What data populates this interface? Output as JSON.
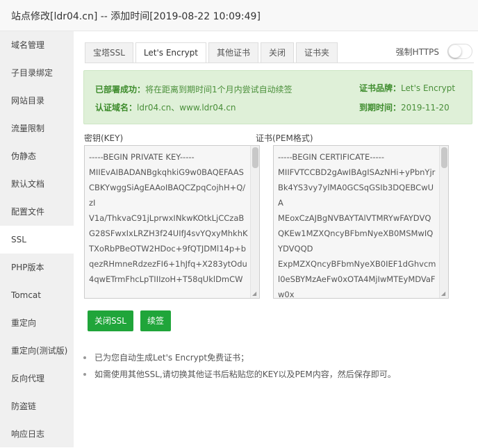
{
  "window": {
    "title": "站点修改[ldr04.cn] -- 添加时间[2019-08-22 10:09:49]"
  },
  "sidebar": {
    "items": [
      {
        "label": "域名管理"
      },
      {
        "label": "子目录绑定"
      },
      {
        "label": "网站目录"
      },
      {
        "label": "流量限制"
      },
      {
        "label": "伪静态"
      },
      {
        "label": "默认文档"
      },
      {
        "label": "配置文件"
      },
      {
        "label": "SSL",
        "active": true
      },
      {
        "label": "PHP版本"
      },
      {
        "label": "Tomcat"
      },
      {
        "label": "重定向"
      },
      {
        "label": "重定向(测试版)"
      },
      {
        "label": "反向代理"
      },
      {
        "label": "防盗链"
      },
      {
        "label": "响应日志"
      }
    ]
  },
  "tabs": [
    {
      "label": "宝塔SSL"
    },
    {
      "label": "Let's Encrypt",
      "active": true
    },
    {
      "label": "其他证书"
    },
    {
      "label": "关闭"
    },
    {
      "label": "证书夹"
    }
  ],
  "force_https": {
    "label": "强制HTTPS",
    "enabled": false
  },
  "status": {
    "deployed_label": "已部署成功：",
    "deployed_value": "将在距离到期时间1个月内尝试自动续签",
    "brand_label": "证书品牌：",
    "brand_value": "Let's Encrypt",
    "domain_label": "认证域名：",
    "domain_value": "ldr04.cn、www.ldr04.cn",
    "expire_label": "到期时间：",
    "expire_value": "2019-11-20"
  },
  "key": {
    "label": "密钥(KEY)",
    "value": "-----BEGIN PRIVATE KEY-----\nMIIEvAIBADANBgkqhkiG9w0BAQEFAASCBKYwggSiAgEAAoIBAQCZpqCojhH+Q/zI\nV1a/ThkvaC91jLprwxINkwKOtkLjCCzaBG28SFwxIxLRZH3f24UIfJ4svYQxyMhkhKTXoRbPBeOTW2HDoc+9fQTJDMl14p+bqezRHmneRdzezFI6+1hJfq+X283ytOdu\n4qwETrmFhcLpTIIIzoH+T58qUklDmCW"
  },
  "cert": {
    "label": "证书(PEM格式)",
    "value": "-----BEGIN CERTIFICATE-----\nMIIFVTCCBD2gAwIBAgISAzNHi+yPbnYjrBk4YS3vy7ylMA0GCSqGSIb3DQEBCwUA\nMEoxCzAJBgNVBAYTAlVTMRYwFAYDVQQKEw1MZXQncyBFbmNyeXB0MSMwIQYDVQQD\nExpMZXQncyBFbmNyeXB0IEF1dGhvcml0eSBYMzAeFw0xOTA4MjIwMTEyMDVaFw0x"
  },
  "buttons": {
    "close_ssl": "关闭SSL",
    "renew": "续签"
  },
  "tips": [
    "已为您自动生成Let's Encrypt免费证书；",
    "如需使用其他SSL,请切换其他证书后粘贴您的KEY以及PEM内容，然后保存即可。"
  ],
  "colors": {
    "accent_green": "#20a53a",
    "alert_bg": "#dff0d8",
    "sidebar_bg": "#f0f0f0"
  }
}
